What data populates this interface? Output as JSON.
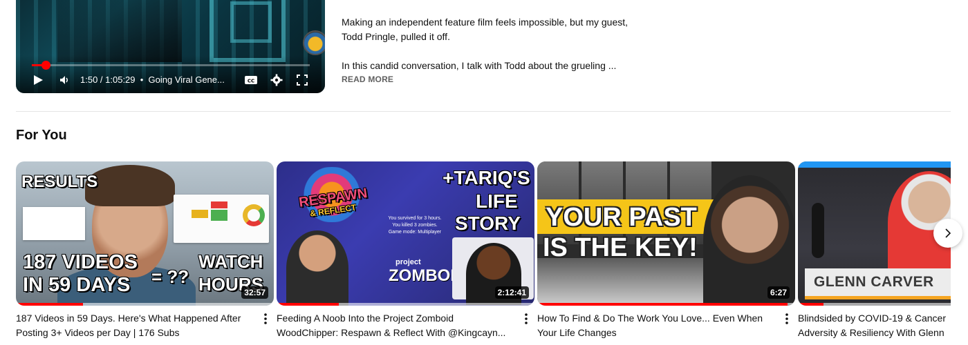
{
  "player": {
    "time": "1:50 / 1:05:29",
    "chapter": "Going Viral Gene...",
    "progress_fraction": 0.05
  },
  "description": {
    "paragraph1": "Making an independent feature film feels impossible, but my guest, Todd Pringle, pulled it off.",
    "paragraph2": "In this candid conversation, I talk with Todd about the grueling ...",
    "read_more": "READ MORE"
  },
  "section": {
    "title": "For You"
  },
  "videos": [
    {
      "title_line1": "187 Videos in 59 Days. Here's What Happened After",
      "title_line2": "Posting 3+ Videos per Day | 176 Subs",
      "duration": "32:57",
      "watched_fraction": 0.26,
      "overlay": [
        "RESULTS",
        "187 VIDEOS",
        "IN 59 DAYS",
        "= ??",
        "WATCH",
        "HOURS"
      ]
    },
    {
      "title_line1": "Feeding A Noob Into the Project Zomboid",
      "title_line2": "WoodChipper: Respawn & Reflect With @Kingcayn...",
      "duration": "2:12:41",
      "watched_fraction": 0.24,
      "overlay": [
        "+TARIQ'S",
        "LIFE",
        "STORY",
        "RESPAWN",
        "& REFLECT",
        "project",
        "ZOMBOID",
        "You survived for 3 hours.",
        "You killed 3 zombies.",
        "Game mode: Multiplayer"
      ]
    },
    {
      "title_line1": "How To Find & Do The Work You Love... Even When",
      "title_line2": "Your Life Changes",
      "duration": "6:27",
      "watched_fraction": 0.97,
      "overlay": [
        "YOUR PAST",
        "IS THE KEY!"
      ]
    },
    {
      "title_line1": "Blindsided by COVID-19 & Cancer",
      "title_line2": "Adversity & Resiliency With Glenn",
      "duration": "",
      "watched_fraction": 0.1,
      "overlay": [
        "GLENN CARVER"
      ]
    }
  ],
  "colors": {
    "accent": "#ff0000",
    "text_primary": "#0f0f0f",
    "text_secondary": "#606060",
    "divider": "#e5e5e5"
  }
}
